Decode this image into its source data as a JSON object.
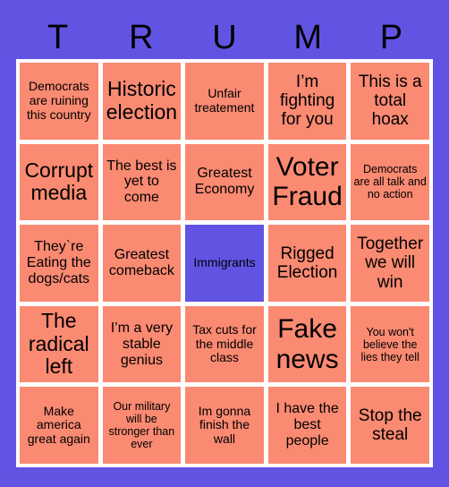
{
  "card": {
    "title_letters": [
      "T",
      "R",
      "U",
      "M",
      "P"
    ],
    "colors": {
      "background": "#6254e3",
      "cell": "#fa8a72",
      "cell_marked": "#6254e3",
      "frame": "#ffffff",
      "text": "#000000"
    },
    "rows": [
      [
        {
          "text": "Democrats are ruining this country",
          "marked": false,
          "size": "fs-s"
        },
        {
          "text": "Historic election",
          "marked": false,
          "size": "fs-xl"
        },
        {
          "text": "Unfair treatement",
          "marked": false,
          "size": "fs-s"
        },
        {
          "text": "I’m fighting for you",
          "marked": false,
          "size": "fs-l"
        },
        {
          "text": "This is a total hoax",
          "marked": false,
          "size": "fs-l"
        }
      ],
      [
        {
          "text": "Corrupt media",
          "marked": false,
          "size": "fs-xl"
        },
        {
          "text": "The best is yet to come",
          "marked": false,
          "size": "fs-m"
        },
        {
          "text": "Greatest Economy",
          "marked": false,
          "size": "fs-m"
        },
        {
          "text": "Voter Fraud",
          "marked": false,
          "size": "fs-xxl"
        },
        {
          "text": "Democrats are all talk and no action",
          "marked": false,
          "size": "fs-xs"
        }
      ],
      [
        {
          "text": "They`re Eating the dogs/cats",
          "marked": false,
          "size": "fs-m"
        },
        {
          "text": "Greatest comeback",
          "marked": false,
          "size": "fs-m"
        },
        {
          "text": "Immigrants",
          "marked": true,
          "size": "fs-s"
        },
        {
          "text": "Rigged Election",
          "marked": false,
          "size": "fs-l"
        },
        {
          "text": "Together we will win",
          "marked": false,
          "size": "fs-l"
        }
      ],
      [
        {
          "text": "The radical left",
          "marked": false,
          "size": "fs-xl"
        },
        {
          "text": "I’m a very stable genius",
          "marked": false,
          "size": "fs-m"
        },
        {
          "text": "Tax cuts for the middle class",
          "marked": false,
          "size": "fs-s"
        },
        {
          "text": "Fake news",
          "marked": false,
          "size": "fs-xxl"
        },
        {
          "text": "You won't believe the lies they tell",
          "marked": false,
          "size": "fs-xs"
        }
      ],
      [
        {
          "text": "Make america great again",
          "marked": false,
          "size": "fs-s"
        },
        {
          "text": "Our military will be stronger than ever",
          "marked": false,
          "size": "fs-xs"
        },
        {
          "text": "Im gonna finish the wall",
          "marked": false,
          "size": "fs-s"
        },
        {
          "text": "I have the best people",
          "marked": false,
          "size": "fs-m"
        },
        {
          "text": "Stop the steal",
          "marked": false,
          "size": "fs-l"
        }
      ]
    ]
  }
}
